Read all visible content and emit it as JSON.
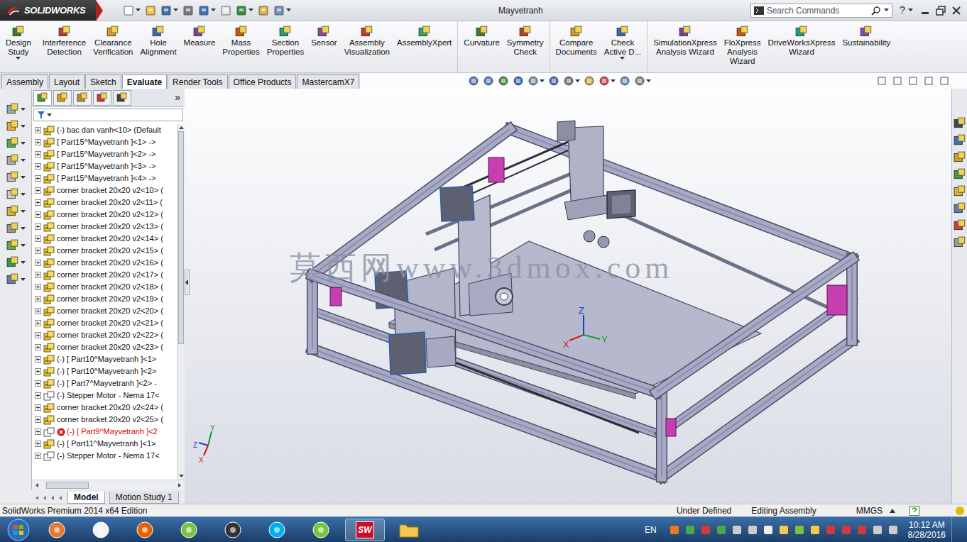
{
  "window": {
    "title": "Mayvetranh",
    "logo": "SOLIDWORKS",
    "help": "?"
  },
  "search": {
    "placeholder": "Search Commands"
  },
  "ribbon_groups": [
    {
      "items": [
        {
          "lines": [
            "Design",
            "Study"
          ],
          "dropdown": true
        }
      ]
    },
    {
      "items": [
        {
          "lines": [
            "Interference",
            "Detection"
          ],
          "dropdown": false
        },
        {
          "lines": [
            "Clearance",
            "Verification"
          ],
          "dropdown": false
        },
        {
          "lines": [
            "Hole",
            "Alignment"
          ],
          "dropdown": false
        },
        {
          "lines": [
            "Measure"
          ],
          "dropdown": false
        },
        {
          "lines": [
            "Mass",
            "Properties"
          ],
          "dropdown": false
        },
        {
          "lines": [
            "Section",
            "Properties"
          ],
          "dropdown": false
        },
        {
          "lines": [
            "Sensor"
          ],
          "dropdown": false
        },
        {
          "lines": [
            "Assembly",
            "Visualization"
          ],
          "dropdown": false
        },
        {
          "lines": [
            "AssemblyXpert"
          ],
          "dropdown": false
        }
      ]
    },
    {
      "items": [
        {
          "lines": [
            "Curvature"
          ],
          "dropdown": false
        },
        {
          "lines": [
            "Symmetry",
            "Check"
          ],
          "dropdown": false
        }
      ]
    },
    {
      "items": [
        {
          "lines": [
            "Compare",
            "Documents"
          ],
          "dropdown": false
        },
        {
          "lines": [
            "Check",
            "Active D..."
          ],
          "dropdown": true
        }
      ]
    },
    {
      "items": [
        {
          "lines": [
            "SimulationXpress",
            "Analysis Wizard"
          ],
          "dropdown": false
        },
        {
          "lines": [
            "FloXpress",
            "Analysis",
            "Wizard"
          ],
          "dropdown": false
        },
        {
          "lines": [
            "DriveWorksXpress",
            "Wizard"
          ],
          "dropdown": false
        },
        {
          "lines": [
            "Sustainability"
          ],
          "dropdown": false
        }
      ]
    }
  ],
  "tabs": [
    {
      "label": "Assembly",
      "selected": false
    },
    {
      "label": "Layout",
      "selected": false
    },
    {
      "label": "Sketch",
      "selected": false
    },
    {
      "label": "Evaluate",
      "selected": true
    },
    {
      "label": "Render Tools",
      "selected": false
    },
    {
      "label": "Office Products",
      "selected": false
    },
    {
      "label": "MastercamX7",
      "selected": false
    }
  ],
  "feature_manager": {
    "more": "»",
    "items": [
      {
        "label": "(-) bac dan vanh<10> (Default",
        "kind": "component",
        "error": false
      },
      {
        "label": "[ Part15^Mayvetranh ]<1> ->",
        "kind": "component",
        "error": false
      },
      {
        "label": "[ Part15^Mayvetranh ]<2> ->",
        "kind": "component",
        "error": false
      },
      {
        "label": "[ Part15^Mayvetranh ]<3> ->",
        "kind": "component",
        "error": false
      },
      {
        "label": "[ Part15^Mayvetranh ]<4> ->",
        "kind": "component",
        "error": false
      },
      {
        "label": "corner bracket 20x20 v2<10> (",
        "kind": "component",
        "error": false
      },
      {
        "label": "corner bracket 20x20 v2<11> (",
        "kind": "component",
        "error": false
      },
      {
        "label": "corner bracket 20x20 v2<12> (",
        "kind": "component",
        "error": false
      },
      {
        "label": "corner bracket 20x20 v2<13> (",
        "kind": "component",
        "error": false
      },
      {
        "label": "corner bracket 20x20 v2<14> (",
        "kind": "component",
        "error": false
      },
      {
        "label": "corner bracket 20x20 v2<15> (",
        "kind": "component",
        "error": false
      },
      {
        "label": "corner bracket 20x20 v2<16> (",
        "kind": "component",
        "error": false
      },
      {
        "label": "corner bracket 20x20 v2<17> (",
        "kind": "component",
        "error": false
      },
      {
        "label": "corner bracket 20x20 v2<18> (",
        "kind": "component",
        "error": false
      },
      {
        "label": "corner bracket 20x20 v2<19> (",
        "kind": "component",
        "error": false
      },
      {
        "label": "corner bracket 20x20 v2<20> (",
        "kind": "component",
        "error": false
      },
      {
        "label": "corner bracket 20x20 v2<21> (",
        "kind": "component",
        "error": false
      },
      {
        "label": "corner bracket 20x20 v2<22> (",
        "kind": "component",
        "error": false
      },
      {
        "label": "corner bracket 20x20 v2<23> (",
        "kind": "component",
        "error": false
      },
      {
        "label": "(-) [ Part10^Mayvetranh ]<1>",
        "kind": "component",
        "error": false
      },
      {
        "label": "(-) [ Part10^Mayvetranh ]<2>",
        "kind": "component",
        "error": false
      },
      {
        "label": "(-) [ Part7^Mayvetranh ]<2> -",
        "kind": "component",
        "error": false
      },
      {
        "label": "(-) Stepper Motor - Nema 17<",
        "kind": "outline",
        "error": false
      },
      {
        "label": "corner bracket 20x20 v2<24> (",
        "kind": "component",
        "error": false
      },
      {
        "label": "corner bracket 20x20 v2<25> (",
        "kind": "component",
        "error": false
      },
      {
        "label": "(-) [ Part9^Mayvetranh ]<2",
        "kind": "outline",
        "error": true
      },
      {
        "label": "(-) [ Part11^Mayvetranh ]<1>",
        "kind": "component",
        "error": false
      },
      {
        "label": "(-) Stepper Motor - Nema 17<",
        "kind": "outline",
        "error": false
      }
    ]
  },
  "bottom_tabs": [
    {
      "label": "Model",
      "selected": true
    },
    {
      "label": "Motion Study 1",
      "selected": false
    }
  ],
  "viewport": {
    "watermark": "莫西网www.3dmox.com",
    "triad": {
      "x": "X",
      "y": "Y",
      "z": "Z"
    },
    "mini_triad": {
      "x": "X",
      "y": "Y",
      "z": "Z"
    }
  },
  "status_bar": {
    "edition": "SolidWorks Premium 2014 x64 Edition",
    "state": "Under Defined",
    "mode": "Editing Assembly",
    "units": "MMGS"
  },
  "taskbar": {
    "sw_label": "SW",
    "language": "EN",
    "time": "10:12 AM",
    "date": "8/28/2016"
  }
}
